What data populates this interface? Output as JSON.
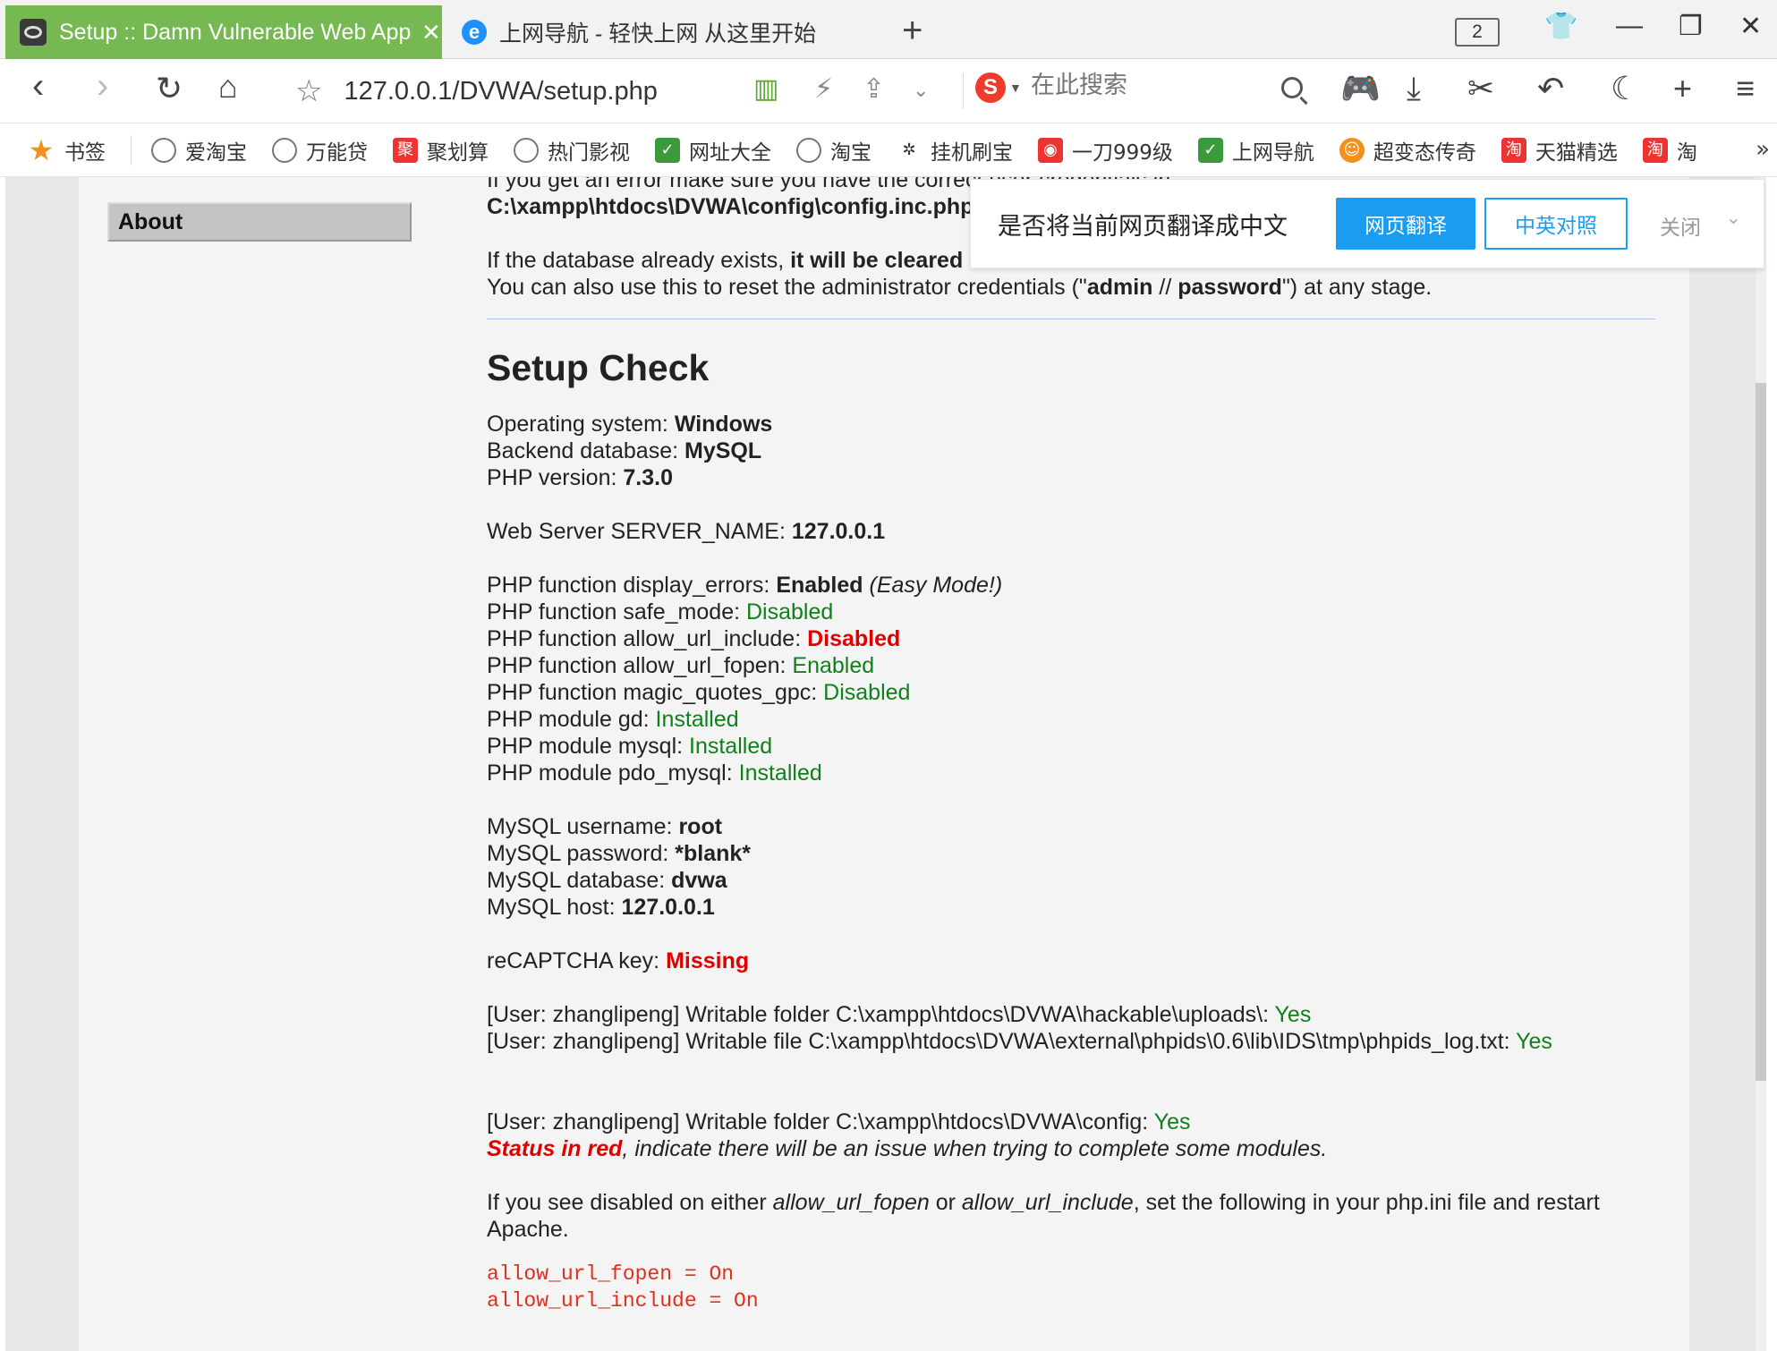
{
  "tabs": {
    "active_title": "Setup :: Damn Vulnerable Web Application",
    "second_title": "上网导航 - 轻快上网 从这里开始",
    "count": "2"
  },
  "address": {
    "url": "127.0.0.1/DVWA/setup.php",
    "search_placeholder": "在此搜索"
  },
  "bookmarks": [
    "书签",
    "爱淘宝",
    "万能贷",
    "聚划算",
    "热门影视",
    "网址大全",
    "淘宝",
    "挂机刷宝",
    "一刀999级",
    "上网导航",
    "超变态传奇",
    "天猫精选",
    "淘"
  ],
  "translate": {
    "prompt": "是否将当前网页翻译成中文",
    "translate_label": "网页翻译",
    "bilingual_label": "中英对照",
    "close_label": "关闭"
  },
  "sidebar": {
    "about": "About"
  },
  "intro": {
    "line1": "If you get an error make sure you have the correct user credentials in:",
    "path": "C:\\xampp\\htdocs\\DVWA\\config\\config.inc.php",
    "db_pre": "If the database already exists, ",
    "db_bold": "it will be cleared and the data will be reset.",
    "reset_pre": "You can also use this to reset the administrator credentials (\"",
    "reset_admin": "admin",
    "reset_mid": " // ",
    "reset_password": "password",
    "reset_post": "\") at any stage."
  },
  "setup": {
    "heading": "Setup Check",
    "os_label": "Operating system: ",
    "os_value": "Windows",
    "db_label": "Backend database: ",
    "db_value": "MySQL",
    "php_label": "PHP version: ",
    "php_value": "7.3.0",
    "server_label": "Web Server SERVER_NAME: ",
    "server_value": "127.0.0.1",
    "display_errors_label": "PHP function display_errors: ",
    "display_errors_value": "Enabled",
    "display_errors_note": " (Easy Mode!)",
    "safe_mode_label": "PHP function safe_mode: ",
    "safe_mode_value": "Disabled",
    "url_include_label": "PHP function allow_url_include: ",
    "url_include_value": "Disabled",
    "url_fopen_label": "PHP function allow_url_fopen: ",
    "url_fopen_value": "Enabled",
    "magic_quotes_label": "PHP function magic_quotes_gpc: ",
    "magic_quotes_value": "Disabled",
    "gd_label": "PHP module gd: ",
    "gd_value": "Installed",
    "mysql_label": "PHP module mysql: ",
    "mysql_value": "Installed",
    "pdo_label": "PHP module pdo_mysql: ",
    "pdo_value": "Installed",
    "mysql_user_label": "MySQL username: ",
    "mysql_user_value": "root",
    "mysql_pass_label": "MySQL password: ",
    "mysql_pass_value": "*blank*",
    "mysql_db_label": "MySQL database: ",
    "mysql_db_value": "dvwa",
    "mysql_host_label": "MySQL host: ",
    "mysql_host_value": "127.0.0.1",
    "recaptcha_label": "reCAPTCHA key: ",
    "recaptcha_value": "Missing",
    "uploads_label": "[User: zhanglipeng] Writable folder C:\\xampp\\htdocs\\DVWA\\hackable\\uploads\\: ",
    "uploads_value": "Yes",
    "phpids_label": "[User: zhanglipeng] Writable file C:\\xampp\\htdocs\\DVWA\\external\\phpids\\0.6\\lib\\IDS\\tmp\\phpids_log.txt: ",
    "phpids_value": "Yes",
    "config_label": "[User: zhanglipeng] Writable folder C:\\xampp\\htdocs\\DVWA\\config: ",
    "config_value": "Yes",
    "status_red": "Status in red",
    "status_note": ", indicate there will be an issue when trying to complete some modules.",
    "disabled_pre": "If you see disabled on either ",
    "disabled_fopen": "allow_url_fopen",
    "disabled_or": " or ",
    "disabled_include": "allow_url_include",
    "disabled_post": ", set the following in your php.ini file and restart Apache.",
    "code_line1": "allow_url_fopen = On",
    "code_line2": "allow_url_include = On"
  },
  "colors": {
    "tab_active": "#76b852",
    "ok_green": "#10801a",
    "error_red": "#e00000",
    "translate_blue": "#1a9cf0"
  }
}
